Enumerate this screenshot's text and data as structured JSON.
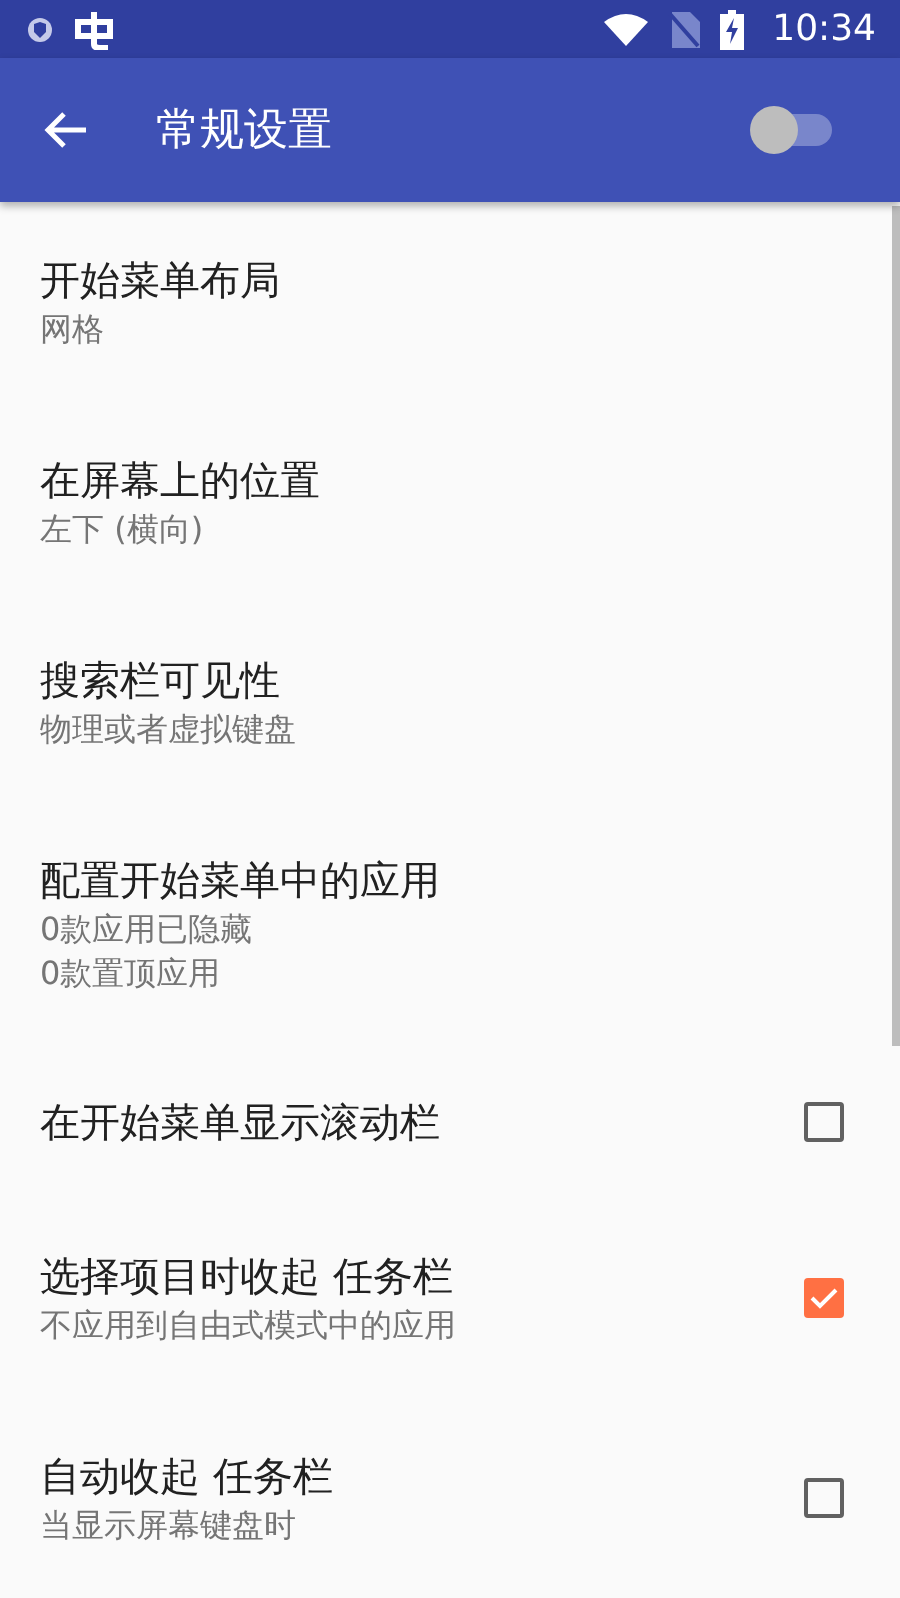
{
  "status_bar": {
    "time": "10:34"
  },
  "toolbar": {
    "title": "常规设置",
    "switch_on": false
  },
  "settings": [
    {
      "kind": "plain",
      "title": "开始菜单布局",
      "summary": [
        "网格"
      ]
    },
    {
      "kind": "plain",
      "title": "在屏幕上的位置",
      "summary": [
        "左下 (横向)"
      ]
    },
    {
      "kind": "plain",
      "title": "搜索栏可见性",
      "summary": [
        "物理或者虚拟键盘"
      ]
    },
    {
      "kind": "plain",
      "title": "配置开始菜单中的应用",
      "summary": [
        "0款应用已隐藏",
        "0款置顶应用"
      ]
    },
    {
      "kind": "checkbox",
      "title": "在开始菜单显示滚动栏",
      "checked": false
    },
    {
      "kind": "checkbox",
      "title": "选择项目时收起 任务栏",
      "summary": [
        "不应用到自由式模式中的应用"
      ],
      "checked": true
    },
    {
      "kind": "checkbox",
      "title": "自动收起 任务栏",
      "summary": [
        "当显示屏幕键盘时"
      ],
      "checked": false
    }
  ]
}
